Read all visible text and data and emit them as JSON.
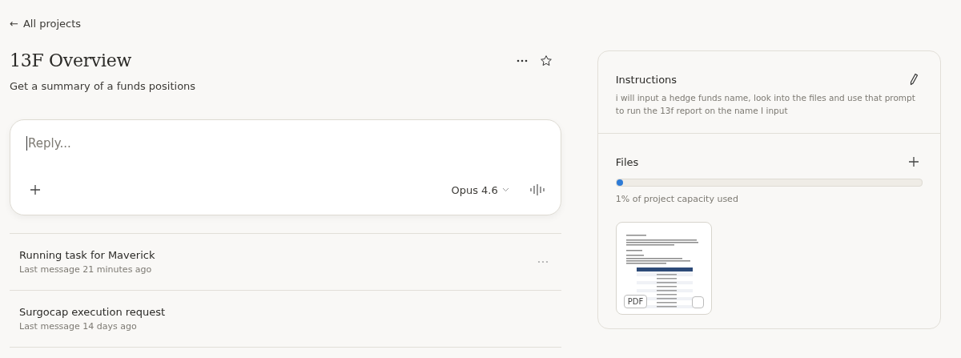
{
  "back_link": {
    "arrow": "←",
    "label": "All projects"
  },
  "project": {
    "title": "13F Overview",
    "description": "Get a summary of a funds positions",
    "starred": false
  },
  "composer": {
    "placeholder": "Reply...",
    "model": "Opus 4.6"
  },
  "conversations": [
    {
      "title": "Running task for Maverick",
      "subtitle": "Last message 21 minutes ago",
      "hovered": true
    },
    {
      "title": "Surgocap execution request",
      "subtitle": "Last message 14 days ago",
      "hovered": false
    }
  ],
  "instructions": {
    "title": "Instructions",
    "text": "i will input a hedge funds name, look into the files and use that prompt to run the 13f report on the name I input"
  },
  "files": {
    "title": "Files",
    "level": 0.01,
    "capacity": "1% of project capacity used",
    "items": [
      {
        "type": "PDF",
        "checked": false
      }
    ]
  }
}
